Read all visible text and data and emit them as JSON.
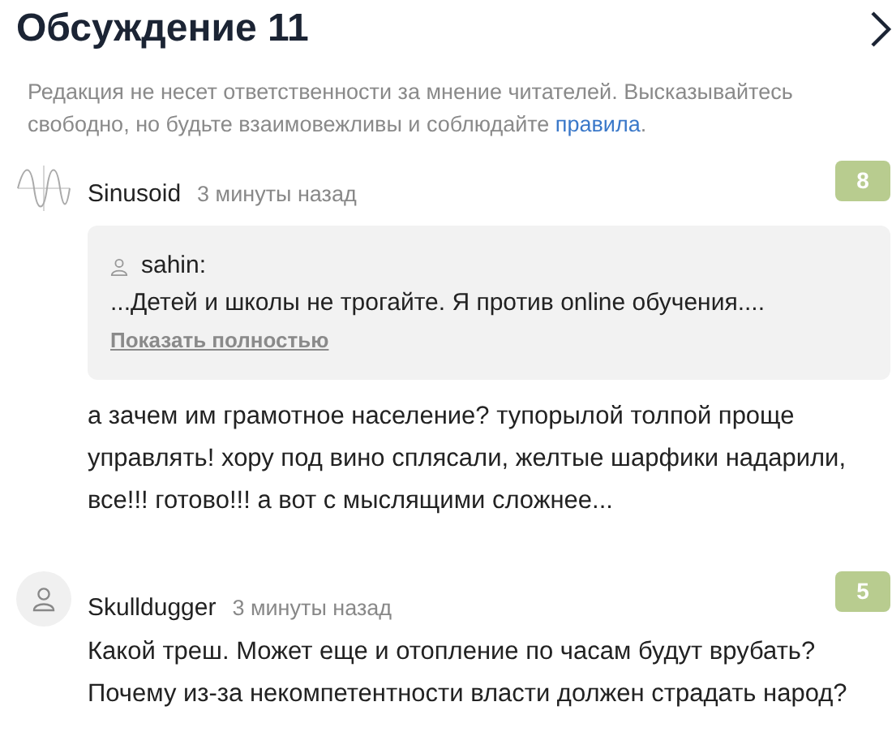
{
  "header": {
    "title": "Обсуждение 11"
  },
  "disclaimer": {
    "text": "Редакция не несет ответственности за мнение читателей. Высказывайтесь свободно, но будьте взаимовежливы и соблюдайте ",
    "link": "правила",
    "tail": "."
  },
  "comments": [
    {
      "author": "Sinusoid",
      "time": "3 минуты назад",
      "rating": "8",
      "avatar": {
        "kind": "wave"
      },
      "quote": {
        "author": "sahin:",
        "text": "...Детей и школы не трогайте. Я против online обучения....",
        "expand": "Показать полностью"
      },
      "text": "а зачем им грамотное население? тупорылой толпой проще управлять! хору под вино сплясали, желтые шарфики надарили, все!!! готово!!! а вот с мыслящими сложнее..."
    },
    {
      "author": "Skulldugger",
      "time": "3 минуты назад",
      "rating": "5",
      "avatar": {
        "kind": "default"
      },
      "text": "Какой треш. Может еще и отопление по часам будут врубать? Почему из-за некомпетентности власти должен страдать народ?"
    }
  ]
}
